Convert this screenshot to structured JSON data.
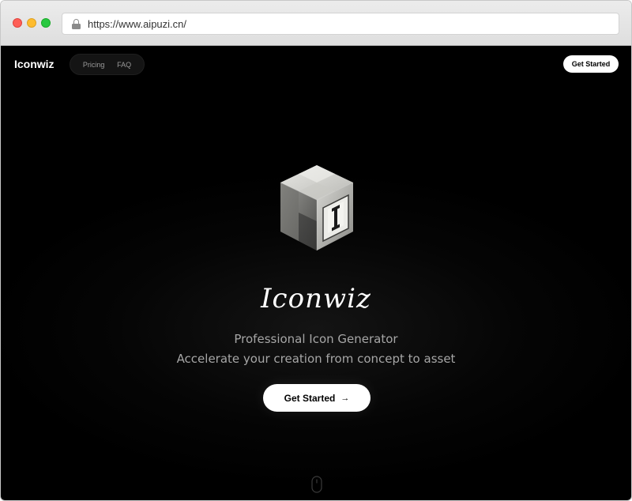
{
  "browser": {
    "url": "https://www.aipuzi.cn/"
  },
  "nav": {
    "brand": "Iconwiz",
    "links": [
      "Pricing",
      "FAQ"
    ],
    "cta": "Get Started"
  },
  "hero": {
    "title": "Iconwiz",
    "subtitle_1": "Professional Icon Generator",
    "subtitle_2": "Accelerate your creation from concept to asset",
    "cta": "Get Started",
    "cta_icon": "arrow-right-icon"
  },
  "icons": {
    "logo": "cube-logo-icon",
    "scroll": "mouse-scroll-icon",
    "lock": "lock-icon"
  },
  "colors": {
    "page_background": "#000000",
    "accent": "#ffffff",
    "muted_text": "#a6a6a6"
  }
}
